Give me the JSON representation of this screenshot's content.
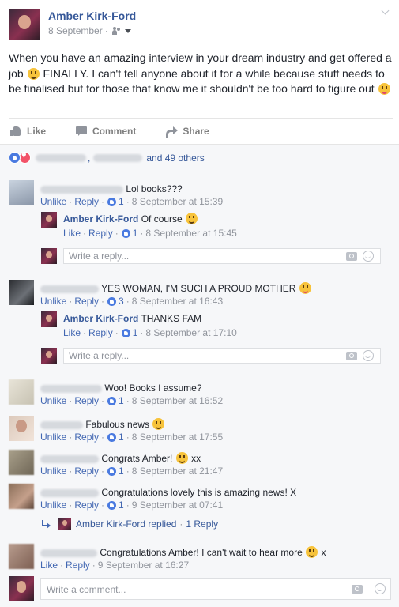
{
  "post": {
    "author": "Amber Kirk-Ford",
    "date": "8 September",
    "text_before_emoji": "When you have an amazing interview in your dream industry and get offered a job",
    "text_after_emoji": "FINALLY. I can't tell anyone about it for a while because stuff needs to be finalised but for those that know me it shouldn't be too hard to figure out",
    "emoji1": "crying-face-emoji",
    "emoji2": "tongue-wink-emoji"
  },
  "actions": {
    "like": "Like",
    "comment": "Comment",
    "share": "Share"
  },
  "reactions": {
    "others_text": "and 49 others",
    "separator": ","
  },
  "comments": [
    {
      "text": "Lol books???",
      "meta": {
        "action": "Unlike",
        "reply": "Reply",
        "likes": "1",
        "time": "8 September at 15:39"
      }
    },
    {
      "text": "YES WOMAN, I'M SUCH A PROUD MOTHER",
      "meta": {
        "action": "Unlike",
        "reply": "Reply",
        "likes": "3",
        "time": "8 September at 16:43"
      }
    },
    {
      "text": "Woo! Books I assume?",
      "meta": {
        "action": "Unlike",
        "reply": "Reply",
        "likes": "1",
        "time": "8 September at 16:52"
      }
    },
    {
      "text": "Fabulous news",
      "meta": {
        "action": "Unlike",
        "reply": "Reply",
        "likes": "1",
        "time": "8 September at 17:55"
      }
    },
    {
      "text": "Congrats Amber!",
      "text_after": "xx",
      "meta": {
        "action": "Unlike",
        "reply": "Reply",
        "likes": "1",
        "time": "8 September at 21:47"
      }
    },
    {
      "text": "Congratulations lovely this is amazing news! X",
      "meta": {
        "action": "Unlike",
        "reply": "Reply",
        "likes": "1",
        "time": "9 September at 07:41"
      }
    },
    {
      "text": "Congratulations Amber! I can't wait to hear more",
      "text_after": "x",
      "meta": {
        "action": "Like",
        "reply": "Reply",
        "time": "9 September at 16:27"
      }
    }
  ],
  "replies": [
    {
      "name": "Amber Kirk-Ford",
      "text": "Of course",
      "meta": {
        "action": "Like",
        "reply": "Reply",
        "likes": "1",
        "time": "8 September at 15:45"
      }
    },
    {
      "name": "Amber Kirk-Ford",
      "text": "THANKS FAM",
      "meta": {
        "action": "Like",
        "reply": "Reply",
        "likes": "1",
        "time": "8 September at 17:10"
      }
    }
  ],
  "reply_box": {
    "placeholder": "Write a reply..."
  },
  "replied_line": {
    "text": "Amber Kirk-Ford replied",
    "sep": "·",
    "count": "1 Reply"
  },
  "write_comment": {
    "placeholder": "Write a comment..."
  },
  "colors": {
    "link": "#365899",
    "meta": "#90949c",
    "like_blue": "#4a7ae0",
    "love_red": "#f25268",
    "background": "#f6f7f9"
  }
}
